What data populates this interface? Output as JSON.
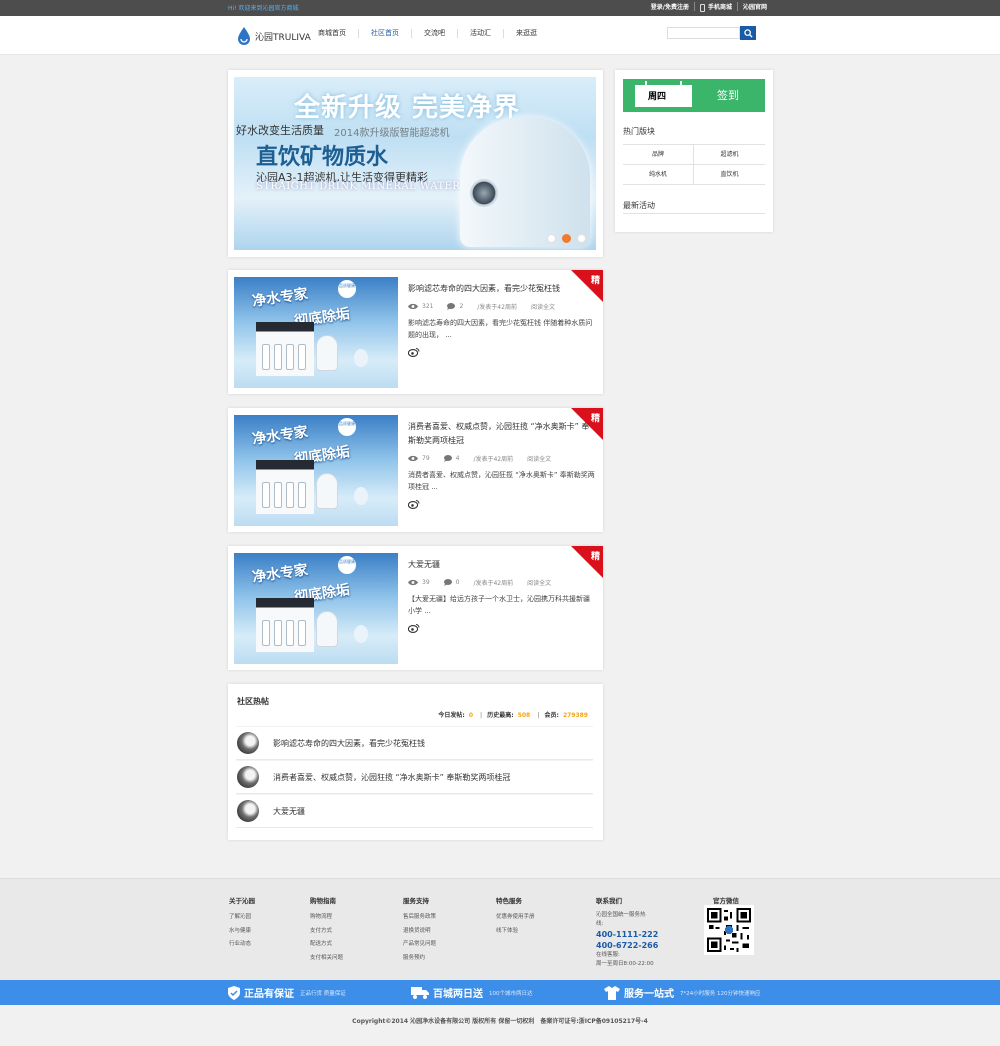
{
  "topbar": {
    "welcome": "Hi! 欢迎来到沁园官方商城",
    "login": "登录/免费注册",
    "mobile": "手机商城",
    "official": "沁园官网"
  },
  "header": {
    "logo_text": "沁园TRULIVA",
    "nav": [
      "商城首页",
      "社区首页",
      "交流吧",
      "活动汇",
      "来逛逛"
    ],
    "active_index": 1,
    "search_placeholder": ""
  },
  "banner": {
    "headline": "全新升级 完美净界",
    "line1": "好水改变生活质量",
    "line2": "2014款升级版智能超滤机",
    "main": "直饮矿物质水",
    "desc": "沁园A3-1超滤机,让生活变得更精彩",
    "en": "STRAIGHT DRINK MINERAL WATER",
    "slides": 3,
    "active_slide": 1
  },
  "post_image": {
    "t1": "净水专家",
    "t2": "彻底除垢",
    "badge": "品质健康"
  },
  "posts": [
    {
      "title": "影响滤芯寿命的四大因素，看完少花冤枉钱",
      "views": "321",
      "comments": "2",
      "published": "/发表于42周前",
      "read_more": "阅读全文",
      "excerpt": "影响滤芯寿命的四大因素，看完少花冤枉钱 伴随着种水质问题的出现， ...",
      "tag": "精"
    },
    {
      "title": "消费者喜爱、权威点赞，沁园狂揽 “净水奥斯卡” 奉斯勒奖两项桂冠",
      "views": "79",
      "comments": "4",
      "published": "/发表于42周前",
      "read_more": "阅读全文",
      "excerpt": "消费者喜爱、权威点赞，沁园狂揽 “净水奥斯卡” 奉斯勒奖两项桂冠 ...",
      "tag": "精"
    },
    {
      "title": "大爱无疆",
      "views": "39",
      "comments": "0",
      "published": "/发表于42周前",
      "read_more": "阅读全文",
      "excerpt": "【大爱无疆】给远方孩子一个水卫士，沁园携万科共援新疆小学 ...",
      "tag": "精"
    }
  ],
  "hot": {
    "title": "社区热帖",
    "today_label": "今日发帖:",
    "today": "0",
    "history_label": "历史最高:",
    "history": "508",
    "members_label": "会员:",
    "members": "279389",
    "items": [
      "影响滤芯寿命的四大因素，看完少花冤枉钱",
      "消费者喜爱、权威点赞，沁园狂揽 “净水奥斯卡” 奉斯勒奖两项桂冠",
      "大爱无疆"
    ]
  },
  "sidebar": {
    "weekday": "周四",
    "sign_label": "签到",
    "hot_boards_title": "热门版块",
    "boards": [
      "品牌",
      "超滤机",
      "纯水机",
      "直饮机"
    ],
    "latest_title": "最新活动"
  },
  "footer": {
    "cols": [
      {
        "title": "关于沁园",
        "links": [
          "了解沁园",
          "水与健康",
          "行业动态"
        ]
      },
      {
        "title": "购物指南",
        "links": [
          "购物流程",
          "支付方式",
          "配送方式",
          "支付相关问题"
        ]
      },
      {
        "title": "服务支持",
        "links": [
          "售后服务政策",
          "退换货说明",
          "产品常见问题",
          "服务预约"
        ]
      },
      {
        "title": "特色服务",
        "links": [
          "优惠券使用手册",
          "线下体验"
        ]
      }
    ],
    "contact": {
      "title": "联系我们",
      "line1": "沁园全国统一服务热",
      "line2": "线:",
      "phone1": "400-1111-222",
      "phone2": "400-6722-266",
      "online": "在线客服:",
      "hours": "周一至周日8:00-22:00"
    },
    "wechat_title": "官方微信"
  },
  "bluebar": [
    {
      "icon": "shield-icon",
      "big": "正品有保证",
      "small": "正品行货 质量保证"
    },
    {
      "icon": "truck-icon",
      "big": "百城两日送",
      "small": "100个城市两日达"
    },
    {
      "icon": "shirt-icon",
      "big": "服务一站式",
      "small": "7*24小时服务 120分钟快速响应"
    }
  ],
  "copyright": "Copyright©2014 沁园净水设备有限公司 版权所有 保留一切权利　备案许可证号:浙ICP备09105217号-4",
  "colors": {
    "brand_blue": "#1a5ba6",
    "sign_green": "#3bb56a",
    "tag_red": "#d8111d",
    "bar_blue": "#3d8ee8",
    "orange": "#f2a51c"
  }
}
